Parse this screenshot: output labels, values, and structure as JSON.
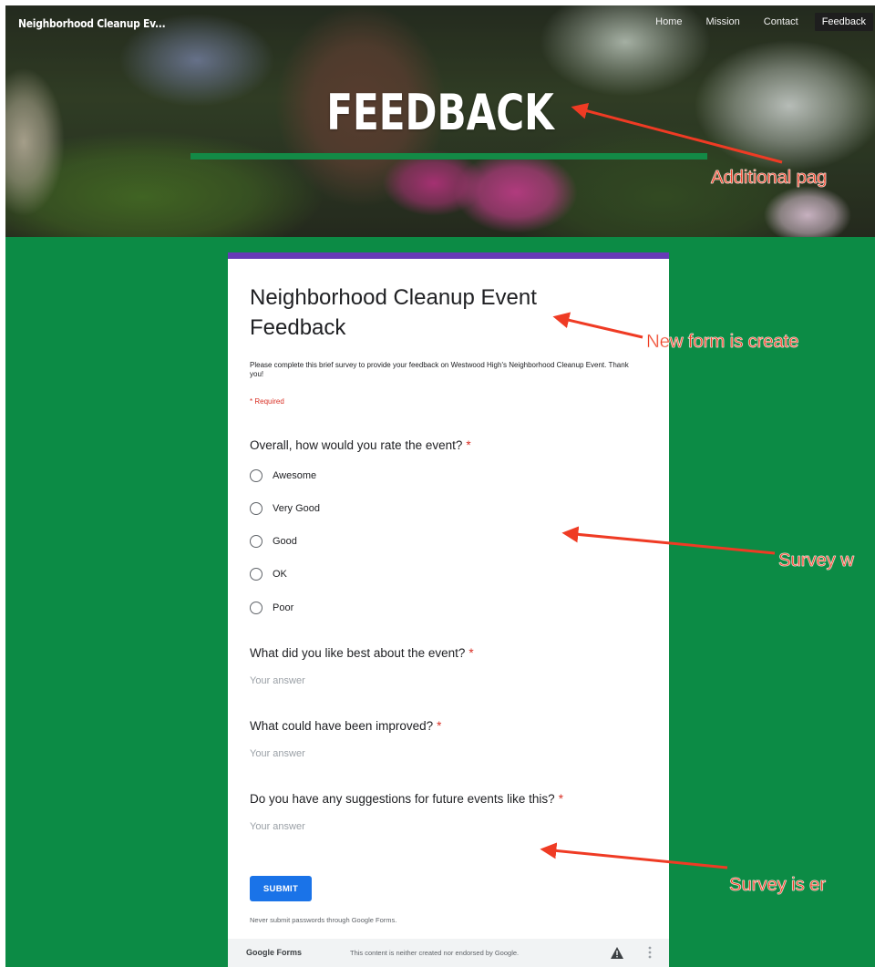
{
  "site": {
    "title": "Neighborhood Cleanup Ev...",
    "nav": [
      "Home",
      "Mission",
      "Contact",
      "Feedback"
    ],
    "active_nav": "Feedback",
    "hero_heading": "FEEDBACK"
  },
  "colors": {
    "green_background": "#0c8b45",
    "hero_rule": "#138a46",
    "form_accent": "#673ab7",
    "submit_button": "#1a73e8",
    "required_red": "#d93025",
    "annotation": "#ef3b24"
  },
  "form": {
    "title": "Neighborhood Cleanup Event Feedback",
    "description": "Please complete this brief survey to provide your feedback on Westwood High's Neighborhood Cleanup Event. Thank you!",
    "required_note": "* Required",
    "q1": {
      "text": "Overall, how would you rate the event?",
      "options": [
        "Awesome",
        "Very Good",
        "Good",
        "OK",
        "Poor"
      ]
    },
    "q2": {
      "text": "What did you like best about the event?",
      "placeholder": "Your answer"
    },
    "q3": {
      "text": "What could have been improved?",
      "placeholder": "Your answer"
    },
    "q4": {
      "text": "Do you have any suggestions for future events like this?",
      "placeholder": "Your answer"
    },
    "required_marker": "*",
    "submit_label": "SUBMIT",
    "password_note": "Never submit passwords through Google Forms.",
    "footer": {
      "brand": "Google Forms",
      "disclaimer": "This content is neither created nor endorsed by Google."
    }
  },
  "annotations": [
    "Additional pag",
    "New form is create",
    "Survey w",
    "Survey is er"
  ],
  "icons": [
    "radio-unchecked-icon",
    "warning-icon",
    "kebab-menu-icon"
  ]
}
